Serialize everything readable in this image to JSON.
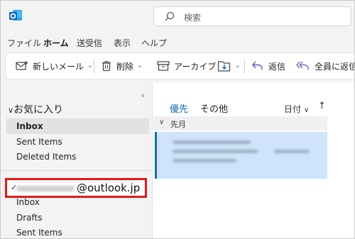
{
  "colors": {
    "accent": "#0f6cbd",
    "highlight_border": "#e3191c",
    "selected_message": "#cfe4fa"
  },
  "search": {
    "placeholder": "検索",
    "icon": "search-icon"
  },
  "menu": {
    "tabs": [
      "ファイル",
      "ホーム",
      "送受信",
      "表示",
      "ヘルプ"
    ],
    "active": "ホーム"
  },
  "ribbon": {
    "new_mail": "新しいメール",
    "delete": "削除",
    "archive": "アーカイブ",
    "reply": "返信",
    "reply_all": "全員に返信"
  },
  "nav": {
    "favorites_label": "お気に入り",
    "favorites": [
      "Inbox",
      "Sent Items",
      "Deleted Items"
    ],
    "account_domain": "@outlook.jp",
    "account_folders": [
      "Inbox",
      "Drafts",
      "Sent Items"
    ]
  },
  "list": {
    "tab_focused": "優先",
    "tab_other": "その他",
    "sort_label": "日付",
    "sort_arrow": "↑",
    "group_label": "先月"
  }
}
